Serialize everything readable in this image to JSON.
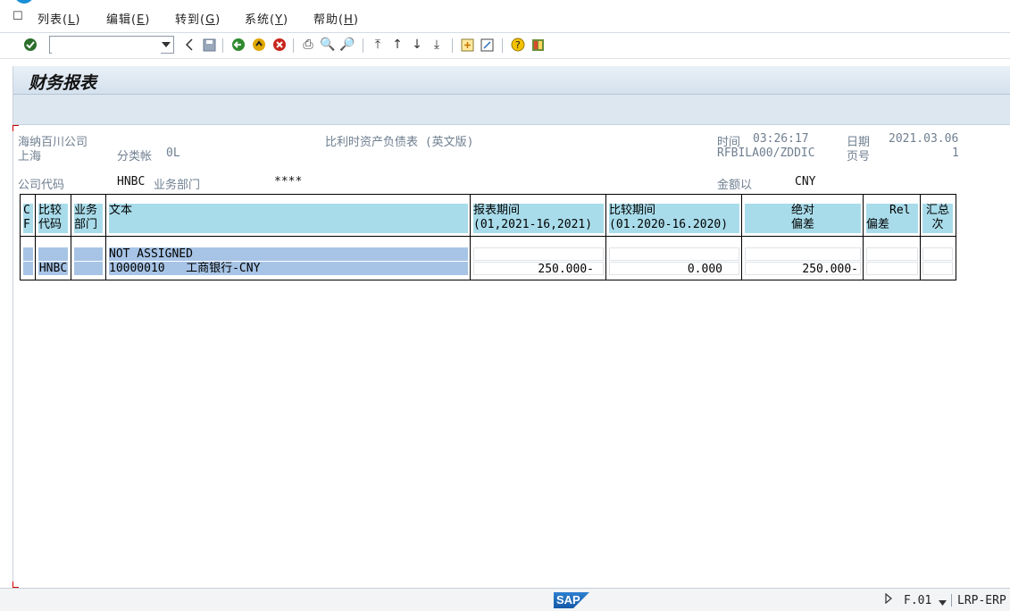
{
  "menu": [
    {
      "label": "列表(",
      "key": "L",
      "end": ")"
    },
    {
      "label": "编辑(",
      "key": "E",
      "end": ")"
    },
    {
      "label": "转到(",
      "key": "G",
      "end": ")"
    },
    {
      "label": "系统(",
      "key": "Y",
      "end": ")"
    },
    {
      "label": "帮助(",
      "key": "H",
      "end": ")"
    }
  ],
  "toolbar": {
    "command_value": ""
  },
  "screen": {
    "title": "财务报表"
  },
  "report_header": {
    "company": "海纳百川公司",
    "city": "上海",
    "ledger_label": "分类帐",
    "ledger_value": "0L",
    "report_title": "比利时资产负债表 (英文版)",
    "time_label": "时间",
    "time_value": "03:26:17",
    "date_label": "日期",
    "date_value": "2021.03.06",
    "program": "RFBILA00/ZDDIC",
    "page_label": "页号",
    "page_value": "1",
    "company_code_label": "公司代码",
    "company_code_value": "HNBC",
    "business_area_label": "业务部门",
    "business_area_value": "****",
    "amount_in_label": "金额以",
    "currency": "CNY"
  },
  "table": {
    "headers": {
      "cf_1": "C",
      "cf_2": "F",
      "compare_1": "比较",
      "compare_2": "代码",
      "busarea_1": "业务",
      "busarea_2": "部门",
      "text": "文本",
      "report_period_1": "报表期间",
      "report_period_2": "(01,2021-16,2021)",
      "compare_period_1": "比较期间",
      "compare_period_2": "(01.2020-16.2020)",
      "abs_diff_1": "绝对",
      "abs_diff_2": "偏差",
      "rel_diff_1": "Rel",
      "rel_diff_2": "偏差",
      "summary_1": "汇总",
      "summary_2": "次"
    },
    "rows": [
      {
        "cf": "",
        "code": "",
        "area": "",
        "text": "NOT ASSIGNED",
        "report": "",
        "compare": "",
        "abs": "",
        "rel": "",
        "sum": ""
      },
      {
        "cf": "",
        "code": "HNBC",
        "area": "",
        "text": "10000010   工商银行-CNY",
        "report": "250.000-",
        "compare": "0.000",
        "abs": "250.000-",
        "rel": "",
        "sum": ""
      }
    ]
  },
  "statusbar": {
    "logo": "SAP",
    "transaction": "F.01",
    "system": "LRP-ERP"
  }
}
